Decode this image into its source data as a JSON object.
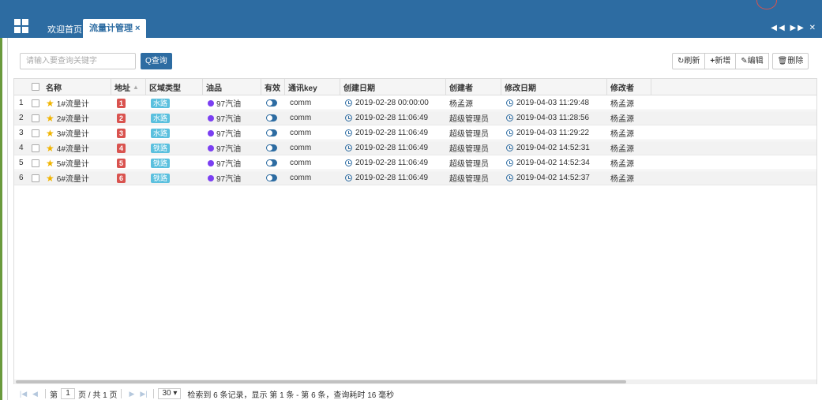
{
  "header": {
    "tabs": [
      {
        "label": "欢迎首页"
      },
      {
        "label": "流量计管理",
        "close": "×"
      }
    ],
    "nav_arrows": "◀◀ ▶▶ ✕"
  },
  "search": {
    "placeholder": "请输入要查询关键字",
    "button": "Q查询"
  },
  "toolbar": {
    "refresh": "刷新",
    "add": "新增",
    "edit": "编辑",
    "delete": "删除"
  },
  "columns": [
    "名称",
    "地址",
    "区域类型",
    "油品",
    "有效",
    "通讯key",
    "创建日期",
    "创建者",
    "修改日期",
    "修改者"
  ],
  "rows": [
    {
      "no": "1",
      "name": "1#流量计",
      "addr": "1",
      "region": "水路",
      "oil": "97汽油",
      "key": "comm",
      "created": "2019-02-28 00:00:00",
      "creator": "杨孟源",
      "modified": "2019-04-03 11:29:48",
      "modifier": "杨孟源"
    },
    {
      "no": "2",
      "name": "2#流量计",
      "addr": "2",
      "region": "水路",
      "oil": "97汽油",
      "key": "comm",
      "created": "2019-02-28 11:06:49",
      "creator": "超级管理员",
      "modified": "2019-04-03 11:28:56",
      "modifier": "杨孟源"
    },
    {
      "no": "3",
      "name": "3#流量计",
      "addr": "3",
      "region": "水路",
      "oil": "97汽油",
      "key": "comm",
      "created": "2019-02-28 11:06:49",
      "creator": "超级管理员",
      "modified": "2019-04-03 11:29:22",
      "modifier": "杨孟源"
    },
    {
      "no": "4",
      "name": "4#流量计",
      "addr": "4",
      "region": "铁路",
      "oil": "97汽油",
      "key": "comm",
      "created": "2019-02-28 11:06:49",
      "creator": "超级管理员",
      "modified": "2019-04-02 14:52:31",
      "modifier": "杨孟源"
    },
    {
      "no": "5",
      "name": "5#流量计",
      "addr": "5",
      "region": "铁路",
      "oil": "97汽油",
      "key": "comm",
      "created": "2019-02-28 11:06:49",
      "creator": "超级管理员",
      "modified": "2019-04-02 14:52:34",
      "modifier": "杨孟源"
    },
    {
      "no": "6",
      "name": "6#流量计",
      "addr": "6",
      "region": "铁路",
      "oil": "97汽油",
      "key": "comm",
      "created": "2019-02-28 11:06:49",
      "creator": "超级管理员",
      "modified": "2019-04-02 14:52:37",
      "modifier": "杨孟源"
    }
  ],
  "pager": {
    "page_prefix": "第",
    "page": "1",
    "page_suffix": "页 / 共 1 页",
    "page_size": "30",
    "summary": "检索到 6 条记录，显示 第 1 条 - 第 6 条，查询耗时 16 毫秒"
  },
  "colors": {
    "primary": "#2d6ca2",
    "address_badge": "#d9534f",
    "region_badge": "#5bc0de",
    "oil_dot": "#7b3ff2",
    "star": "#f0b400"
  }
}
